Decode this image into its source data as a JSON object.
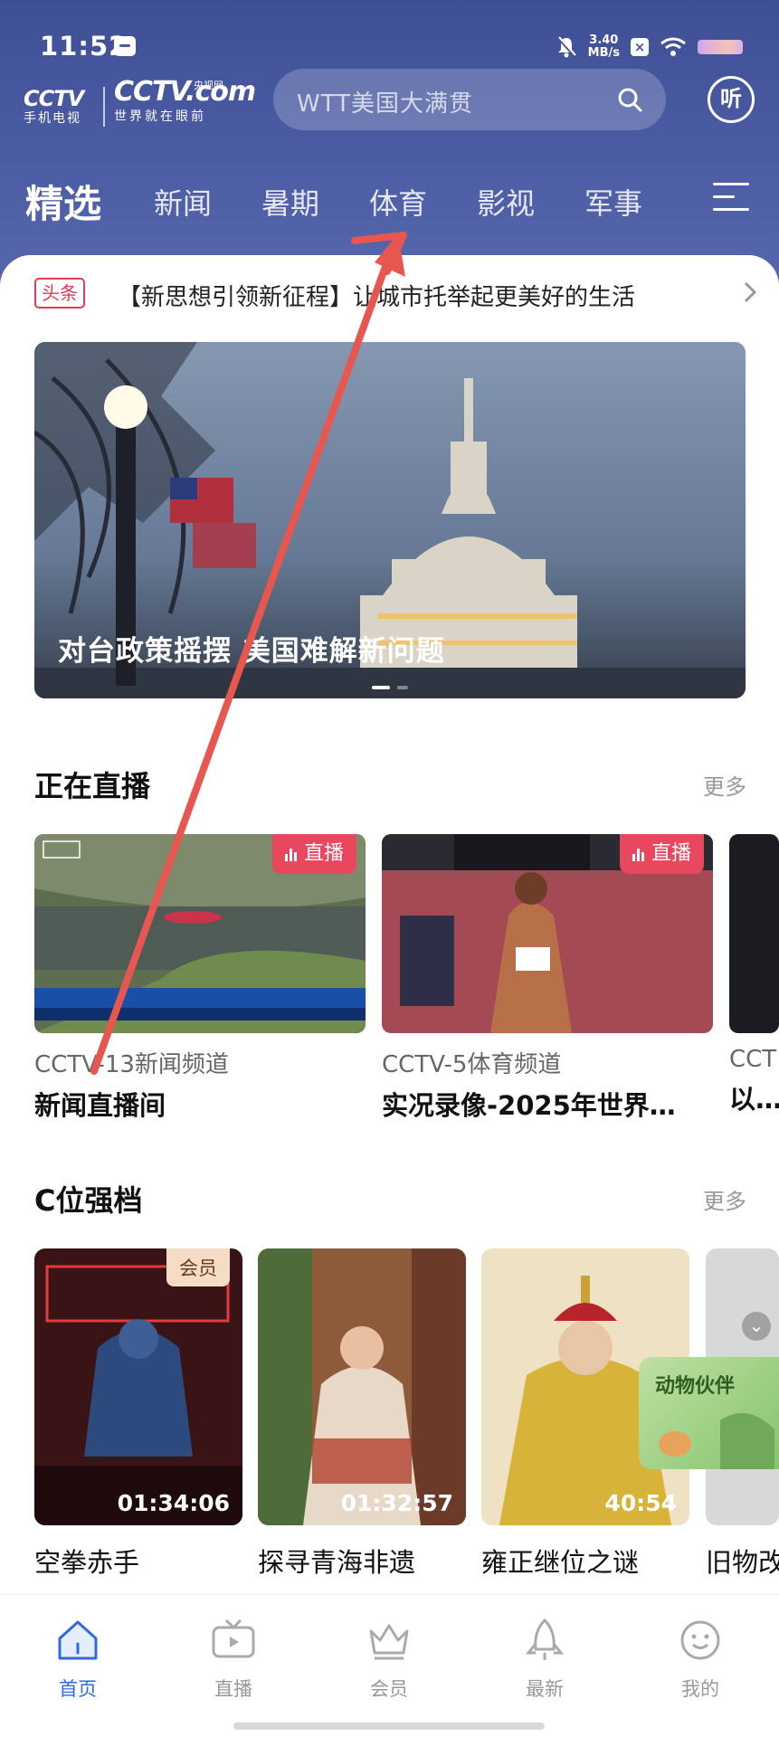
{
  "status_bar": {
    "time": "11:52",
    "net_speed_value": "3.40",
    "net_speed_unit": "MB/s"
  },
  "logo": {
    "cctv_brand": "CCTV",
    "cctv_sub": "手机电视",
    "com_brand": "CCTV.com",
    "com_tag": "央视网",
    "com_sub": "世界就在眼前"
  },
  "search": {
    "placeholder": "WTT美国大满贯"
  },
  "listen_button": "听",
  "tabs": [
    {
      "label": "精选",
      "active": true
    },
    {
      "label": "新闻"
    },
    {
      "label": "暑期"
    },
    {
      "label": "体育"
    },
    {
      "label": "影视"
    },
    {
      "label": "军事"
    }
  ],
  "headline": {
    "badge": "头条",
    "text": "【新思想引领新征程】让城市托举起更美好的生活"
  },
  "hero": {
    "title": "对台政策摇摆 美国难解新问题"
  },
  "live_section": {
    "title": "正在直播",
    "more": "更多",
    "items": [
      {
        "badge": "直播",
        "channel": "CCTV-13新闻频道",
        "program": "新闻直播间"
      },
      {
        "badge": "直播",
        "channel": "CCTV-5体育频道",
        "program": "实况录像-2025年世界…"
      },
      {
        "channel": "CCT",
        "program": "以法"
      }
    ]
  },
  "c_section": {
    "title": "C位强档",
    "more": "更多",
    "items": [
      {
        "badge": "会员",
        "duration": "01:34:06",
        "title": "空拳赤手"
      },
      {
        "duration": "01:32:57",
        "title": "探寻青海非遗"
      },
      {
        "duration": "40:54",
        "title": "雍正继位之谜"
      },
      {
        "title": "旧物改"
      }
    ]
  },
  "floating_ad": {
    "text": "动物伙伴"
  },
  "bottom_nav": [
    {
      "label": "首页",
      "active": true
    },
    {
      "label": "直播"
    },
    {
      "label": "会员"
    },
    {
      "label": "最新"
    },
    {
      "label": "我的"
    }
  ],
  "colors": {
    "header_bg": "#4a5aa2",
    "accent_red": "#e8475e",
    "nav_active": "#2f6ae0",
    "annotation_arrow": "#e8574f"
  }
}
